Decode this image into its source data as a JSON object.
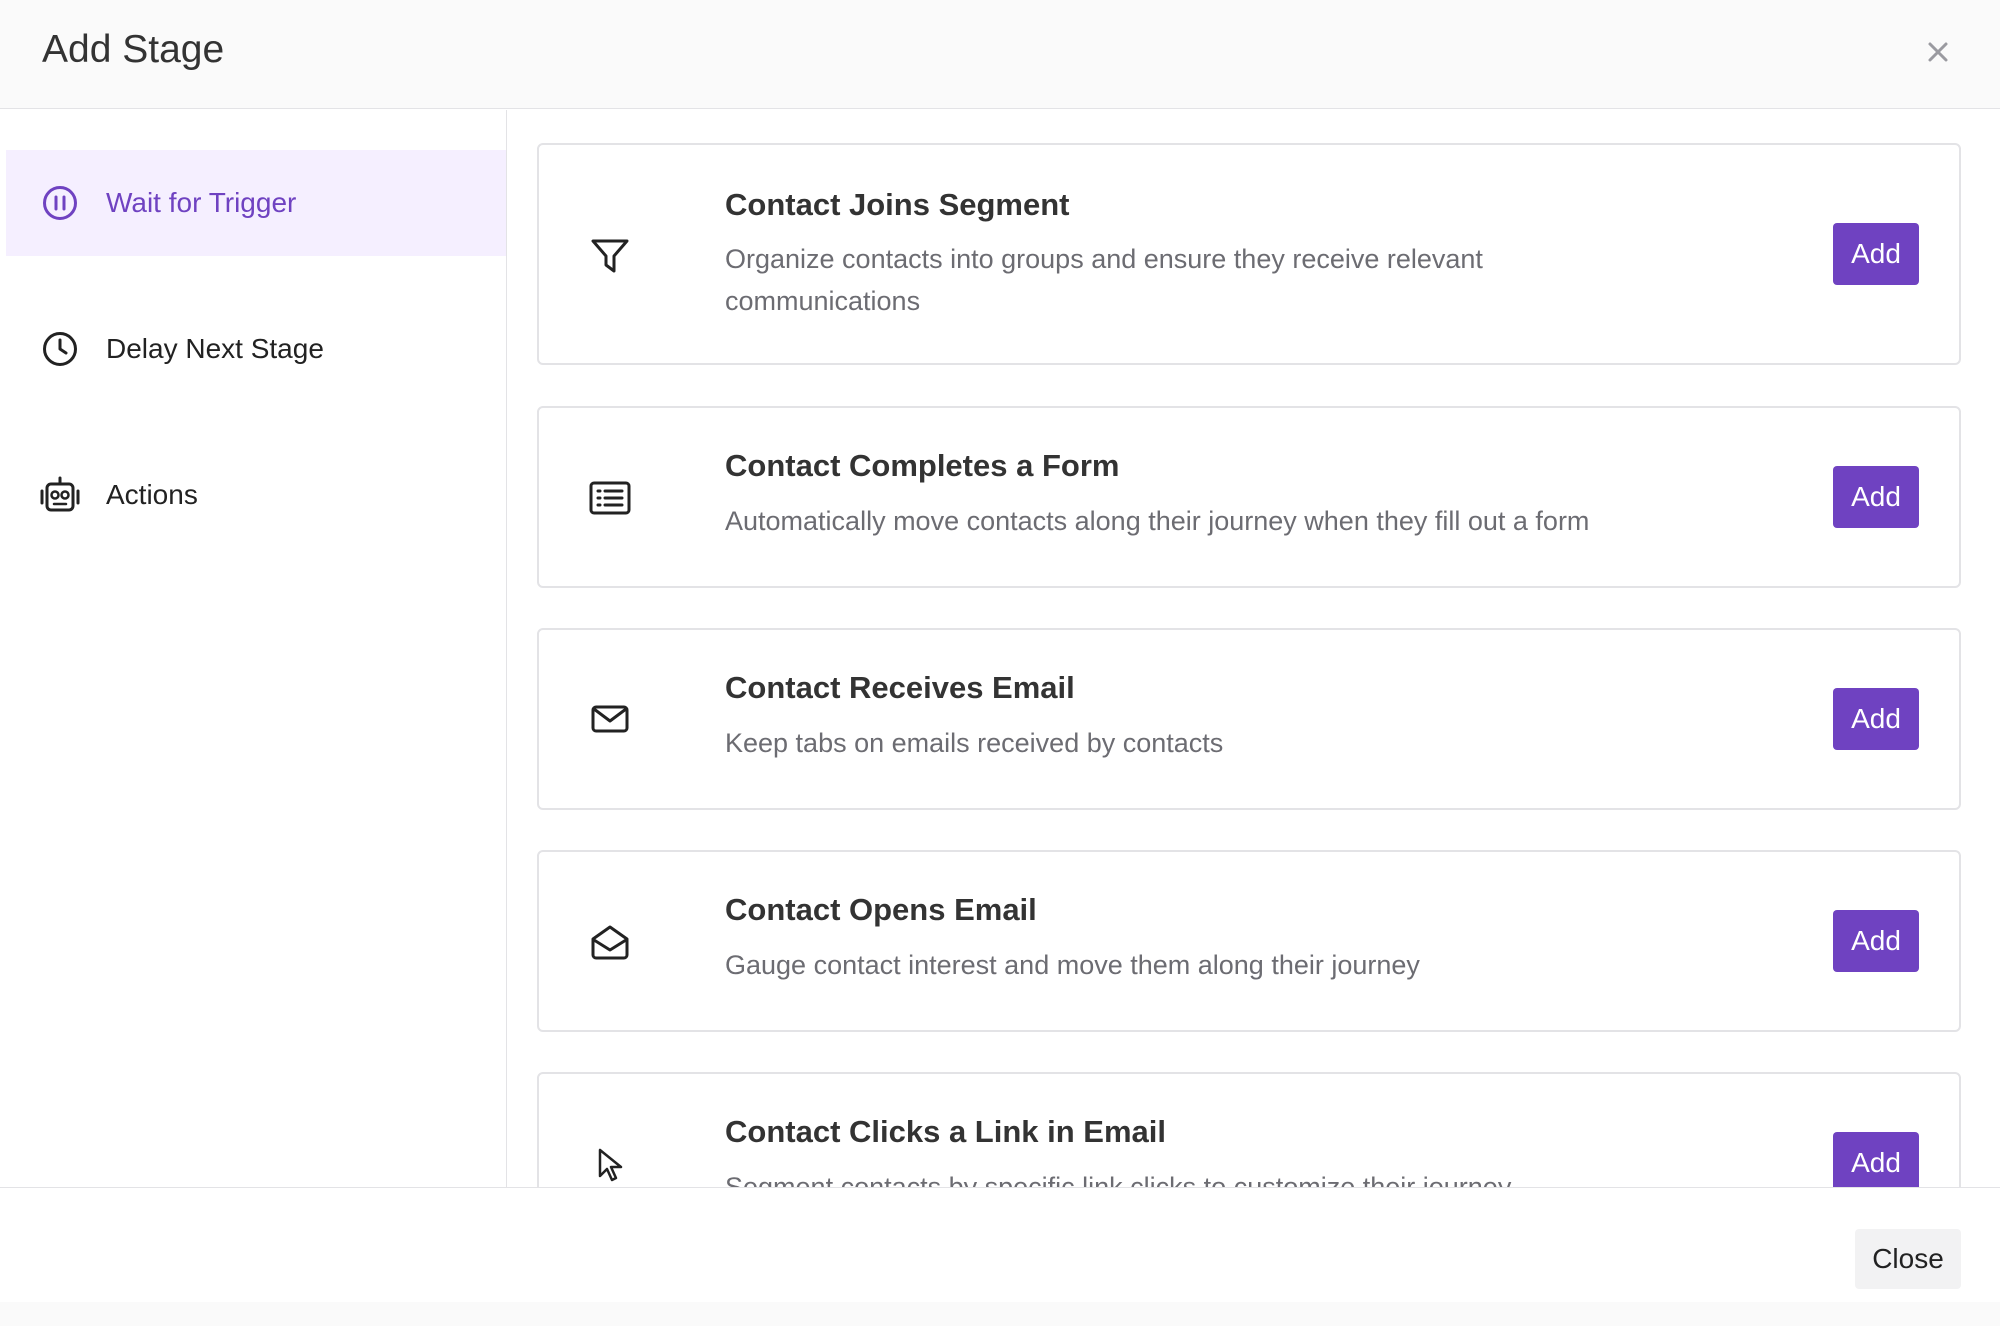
{
  "header": {
    "title": "Add Stage",
    "close_icon": "close-icon"
  },
  "sidebar": {
    "items": [
      {
        "label": "Wait for Trigger",
        "icon": "pause-circle-icon",
        "active": true
      },
      {
        "label": "Delay Next Stage",
        "icon": "clock-icon",
        "active": false
      },
      {
        "label": "Actions",
        "icon": "robot-icon",
        "active": false
      }
    ]
  },
  "triggers": [
    {
      "title": "Contact Joins Segment",
      "description": "Organize contacts into groups and ensure they receive relevant communications",
      "icon": "filter-icon",
      "button": "Add"
    },
    {
      "title": "Contact Completes a Form",
      "description": "Automatically move contacts along their journey when they fill out a form",
      "icon": "form-list-icon",
      "button": "Add"
    },
    {
      "title": "Contact Receives Email",
      "description": "Keep tabs on emails received by contacts",
      "icon": "envelope-icon",
      "button": "Add"
    },
    {
      "title": "Contact Opens Email",
      "description": "Gauge contact interest and move them along their journey",
      "icon": "envelope-open-icon",
      "button": "Add"
    },
    {
      "title": "Contact Clicks a Link in Email",
      "description": "Segment contacts by specific link clicks to customize their journey",
      "icon": "cursor-icon",
      "button": "Add"
    }
  ],
  "footer": {
    "close_label": "Close"
  },
  "colors": {
    "accent": "#6f42c1",
    "active_bg": "#f5efff",
    "border": "#e3e3e6"
  }
}
